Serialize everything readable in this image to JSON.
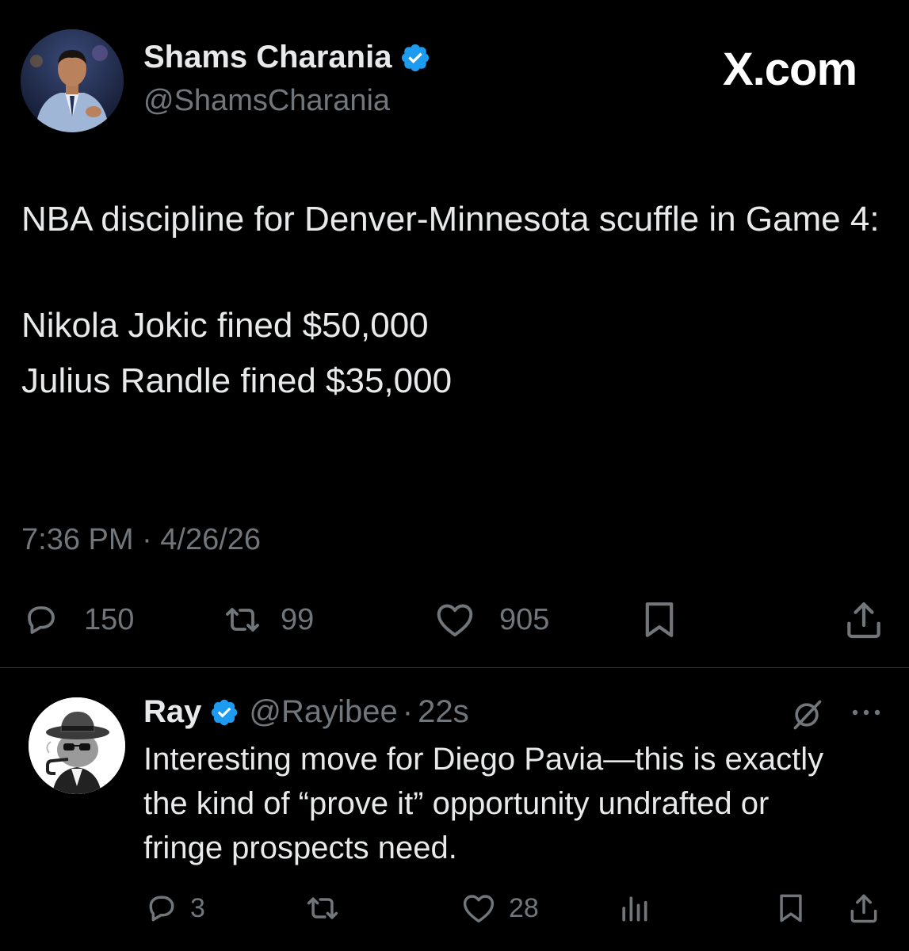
{
  "brand": "X.com",
  "tweet": {
    "author": {
      "name": "Shams Charania",
      "handle": "@ShamsCharania",
      "verified": true,
      "avatar_icon": "avatar-photo-man-in-suit"
    },
    "text": {
      "line1": "NBA discipline for Denver-Minnesota scuffle in Game 4:",
      "line2": "Nikola Jokic fined $50,000",
      "line3": "Julius Randle fined $35,000"
    },
    "timestamp": "7:36 PM · 4/26/26",
    "actions": {
      "replies": "150",
      "reposts": "99",
      "likes": "905"
    }
  },
  "reply": {
    "author": {
      "name": "Ray",
      "handle": "@Rayibee",
      "separator": "·",
      "time": "22s",
      "verified": true,
      "avatar_icon": "avatar-cat-in-fedora"
    },
    "text": "Interesting move for Diego Pavia—this is exactly the kind of “prove it” opportunity undrafted or fringe prospects need.",
    "actions": {
      "replies": "3",
      "reposts": "",
      "likes": "28"
    }
  },
  "colors": {
    "background": "#000000",
    "text": "#e7e9ea",
    "muted": "#71767b",
    "verified_blue": "#1d9bf0",
    "divider": "#2f3336"
  }
}
